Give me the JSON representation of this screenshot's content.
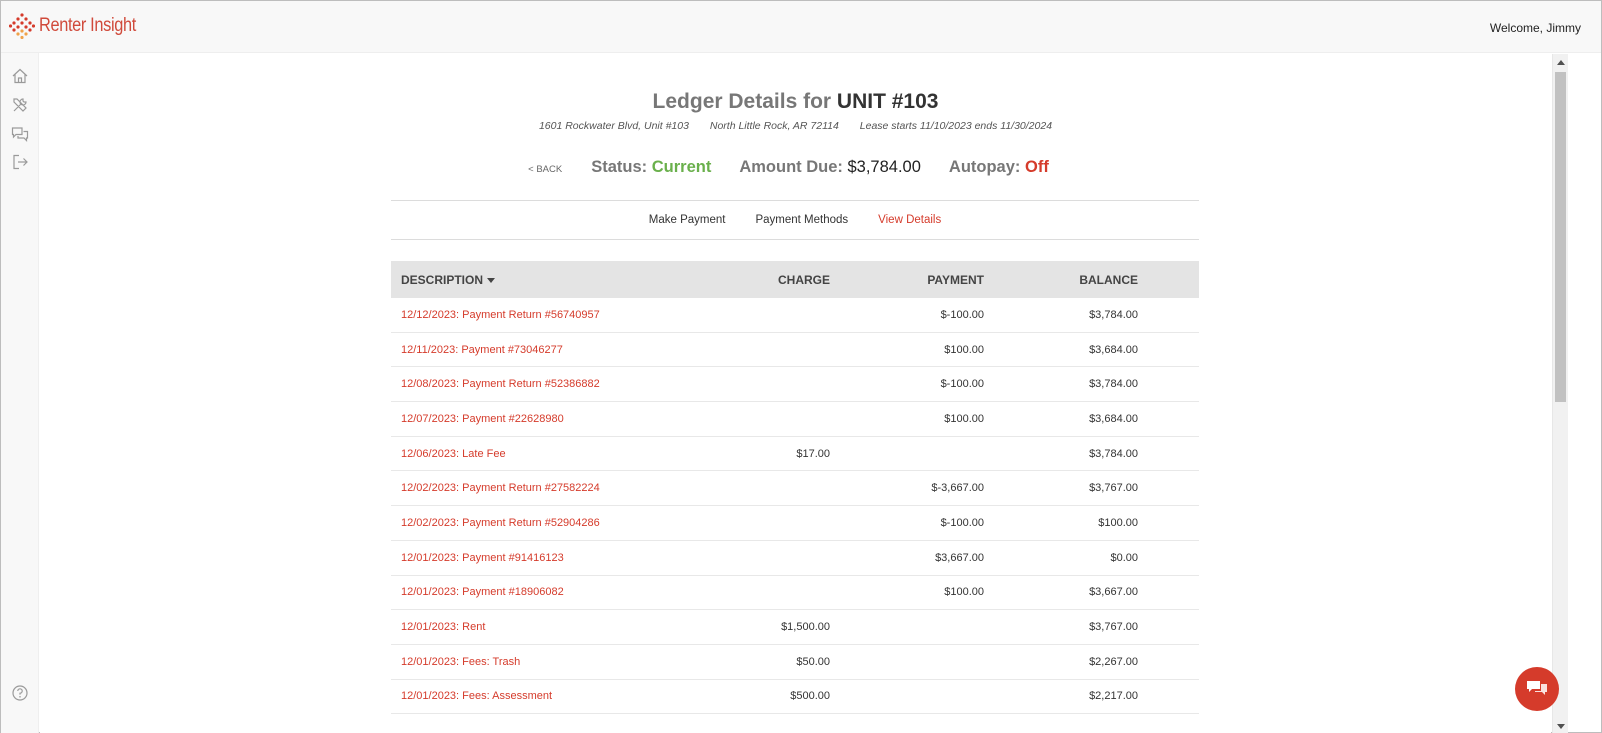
{
  "app": {
    "name": "Renter Insight",
    "welcome": "Welcome, Jimmy"
  },
  "sidebar": {
    "items": [
      {
        "name": "home-icon"
      },
      {
        "name": "tools-icon"
      },
      {
        "name": "messages-icon"
      },
      {
        "name": "logout-icon"
      },
      {
        "name": "help-icon"
      }
    ]
  },
  "ledger": {
    "title_prefix": "Ledger Details for",
    "unit": "UNIT #103",
    "address": "1601 Rockwater Blvd, Unit #103",
    "city": "North Little Rock, AR 72114",
    "lease": "Lease starts 11/10/2023 ends 11/30/2024",
    "back": "< BACK",
    "status_label": "Status:",
    "status_value": "Current",
    "amount_due_label": "Amount Due:",
    "amount_due_value": "$3,784.00",
    "autopay_label": "Autopay:",
    "autopay_value": "Off"
  },
  "tabs": [
    {
      "label": "Make Payment",
      "active": false
    },
    {
      "label": "Payment Methods",
      "active": false
    },
    {
      "label": "View Details",
      "active": true
    }
  ],
  "table": {
    "headers": {
      "description": "DESCRIPTION",
      "charge": "CHARGE",
      "payment": "PAYMENT",
      "balance": "BALANCE"
    },
    "rows": [
      {
        "description": "12/12/2023: Payment Return #56740957",
        "charge": "",
        "payment": "$-100.00",
        "balance": "$3,784.00"
      },
      {
        "description": "12/11/2023: Payment #73046277",
        "charge": "",
        "payment": "$100.00",
        "balance": "$3,684.00"
      },
      {
        "description": "12/08/2023: Payment Return #52386882",
        "charge": "",
        "payment": "$-100.00",
        "balance": "$3,784.00"
      },
      {
        "description": "12/07/2023: Payment #22628980",
        "charge": "",
        "payment": "$100.00",
        "balance": "$3,684.00"
      },
      {
        "description": "12/06/2023: Late Fee",
        "charge": "$17.00",
        "payment": "",
        "balance": "$3,784.00"
      },
      {
        "description": "12/02/2023: Payment Return #27582224",
        "charge": "",
        "payment": "$-3,667.00",
        "balance": "$3,767.00"
      },
      {
        "description": "12/02/2023: Payment Return #52904286",
        "charge": "",
        "payment": "$-100.00",
        "balance": "$100.00"
      },
      {
        "description": "12/01/2023: Payment #91416123",
        "charge": "",
        "payment": "$3,667.00",
        "balance": "$0.00"
      },
      {
        "description": "12/01/2023: Payment #18906082",
        "charge": "",
        "payment": "$100.00",
        "balance": "$3,667.00"
      },
      {
        "description": "12/01/2023: Rent",
        "charge": "$1,500.00",
        "payment": "",
        "balance": "$3,767.00"
      },
      {
        "description": "12/01/2023: Fees: Trash",
        "charge": "$50.00",
        "payment": "",
        "balance": "$2,267.00"
      },
      {
        "description": "12/01/2023: Fees: Assessment",
        "charge": "$500.00",
        "payment": "",
        "balance": "$2,217.00"
      }
    ]
  },
  "colors": {
    "accent": "#d53b2b",
    "status_green": "#6ab04c",
    "header_bg": "#e4e4e4"
  }
}
